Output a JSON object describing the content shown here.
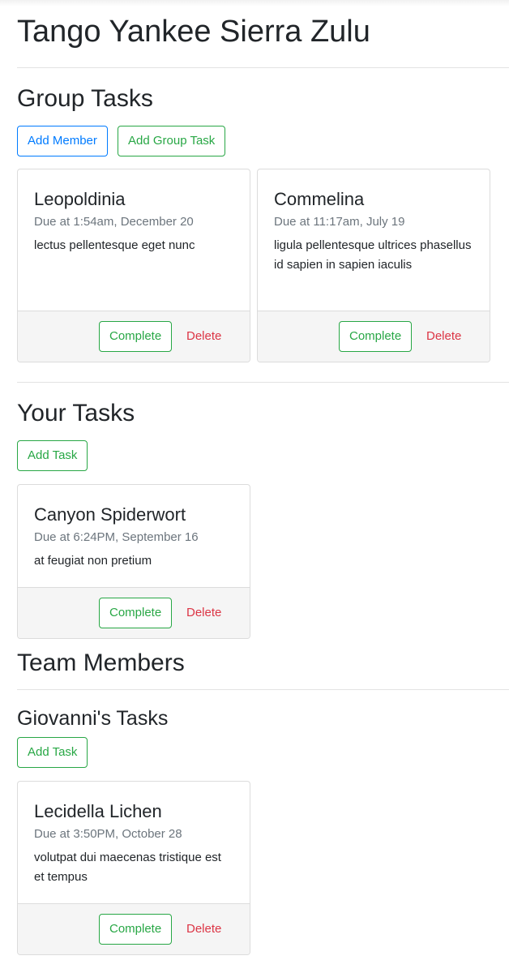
{
  "page": {
    "title": "Tango Yankee Sierra Zulu"
  },
  "group": {
    "heading": "Group Tasks",
    "add_member_label": "Add Member",
    "add_group_task_label": "Add Group Task",
    "tasks": [
      {
        "title": "Leopoldinia",
        "due": "Due at 1:54am, December 20",
        "text": "lectus pellentesque eget nunc",
        "complete_label": "Complete",
        "delete_label": "Delete"
      },
      {
        "title": "Commelina",
        "due": "Due at 11:17am, July 19",
        "text": "ligula pellentesque ultrices phasellus id sapien in sapien iaculis",
        "complete_label": "Complete",
        "delete_label": "Delete"
      }
    ]
  },
  "yours": {
    "heading": "Your Tasks",
    "add_task_label": "Add Task",
    "tasks": [
      {
        "title": "Canyon Spiderwort",
        "due": "Due at 6:24PM, September 16",
        "text": "at feugiat non pretium",
        "complete_label": "Complete",
        "delete_label": "Delete"
      }
    ]
  },
  "team": {
    "heading": "Team Members",
    "members": [
      {
        "heading": "Giovanni's Tasks",
        "add_task_label": "Add Task",
        "tasks": [
          {
            "title": "Lecidella Lichen",
            "due": "Due at 3:50PM, October 28",
            "text": "volutpat dui maecenas tristique est et tempus",
            "complete_label": "Complete",
            "delete_label": "Delete"
          }
        ]
      }
    ]
  }
}
